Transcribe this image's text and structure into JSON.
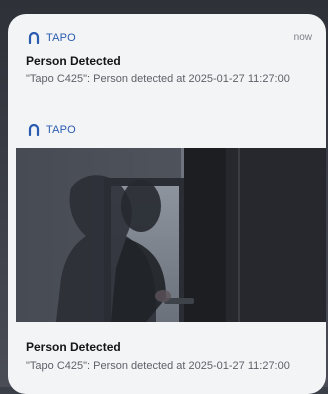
{
  "notifications": [
    {
      "app": "TAPO",
      "time": "now",
      "title": "Person Detected",
      "body": "\"Tapo C425\": Person detected at 2025-01-27 11:27:00"
    },
    {
      "app": "TAPO",
      "title": "Person Detected",
      "body": "\"Tapo C425\": Person detected at 2025-01-27 11:27:00",
      "image": "security-camera-snapshot"
    }
  ],
  "colors": {
    "accent": "#2a5bb0",
    "panel": "#f3f4f6",
    "title": "#141518",
    "body": "#5e6168"
  }
}
